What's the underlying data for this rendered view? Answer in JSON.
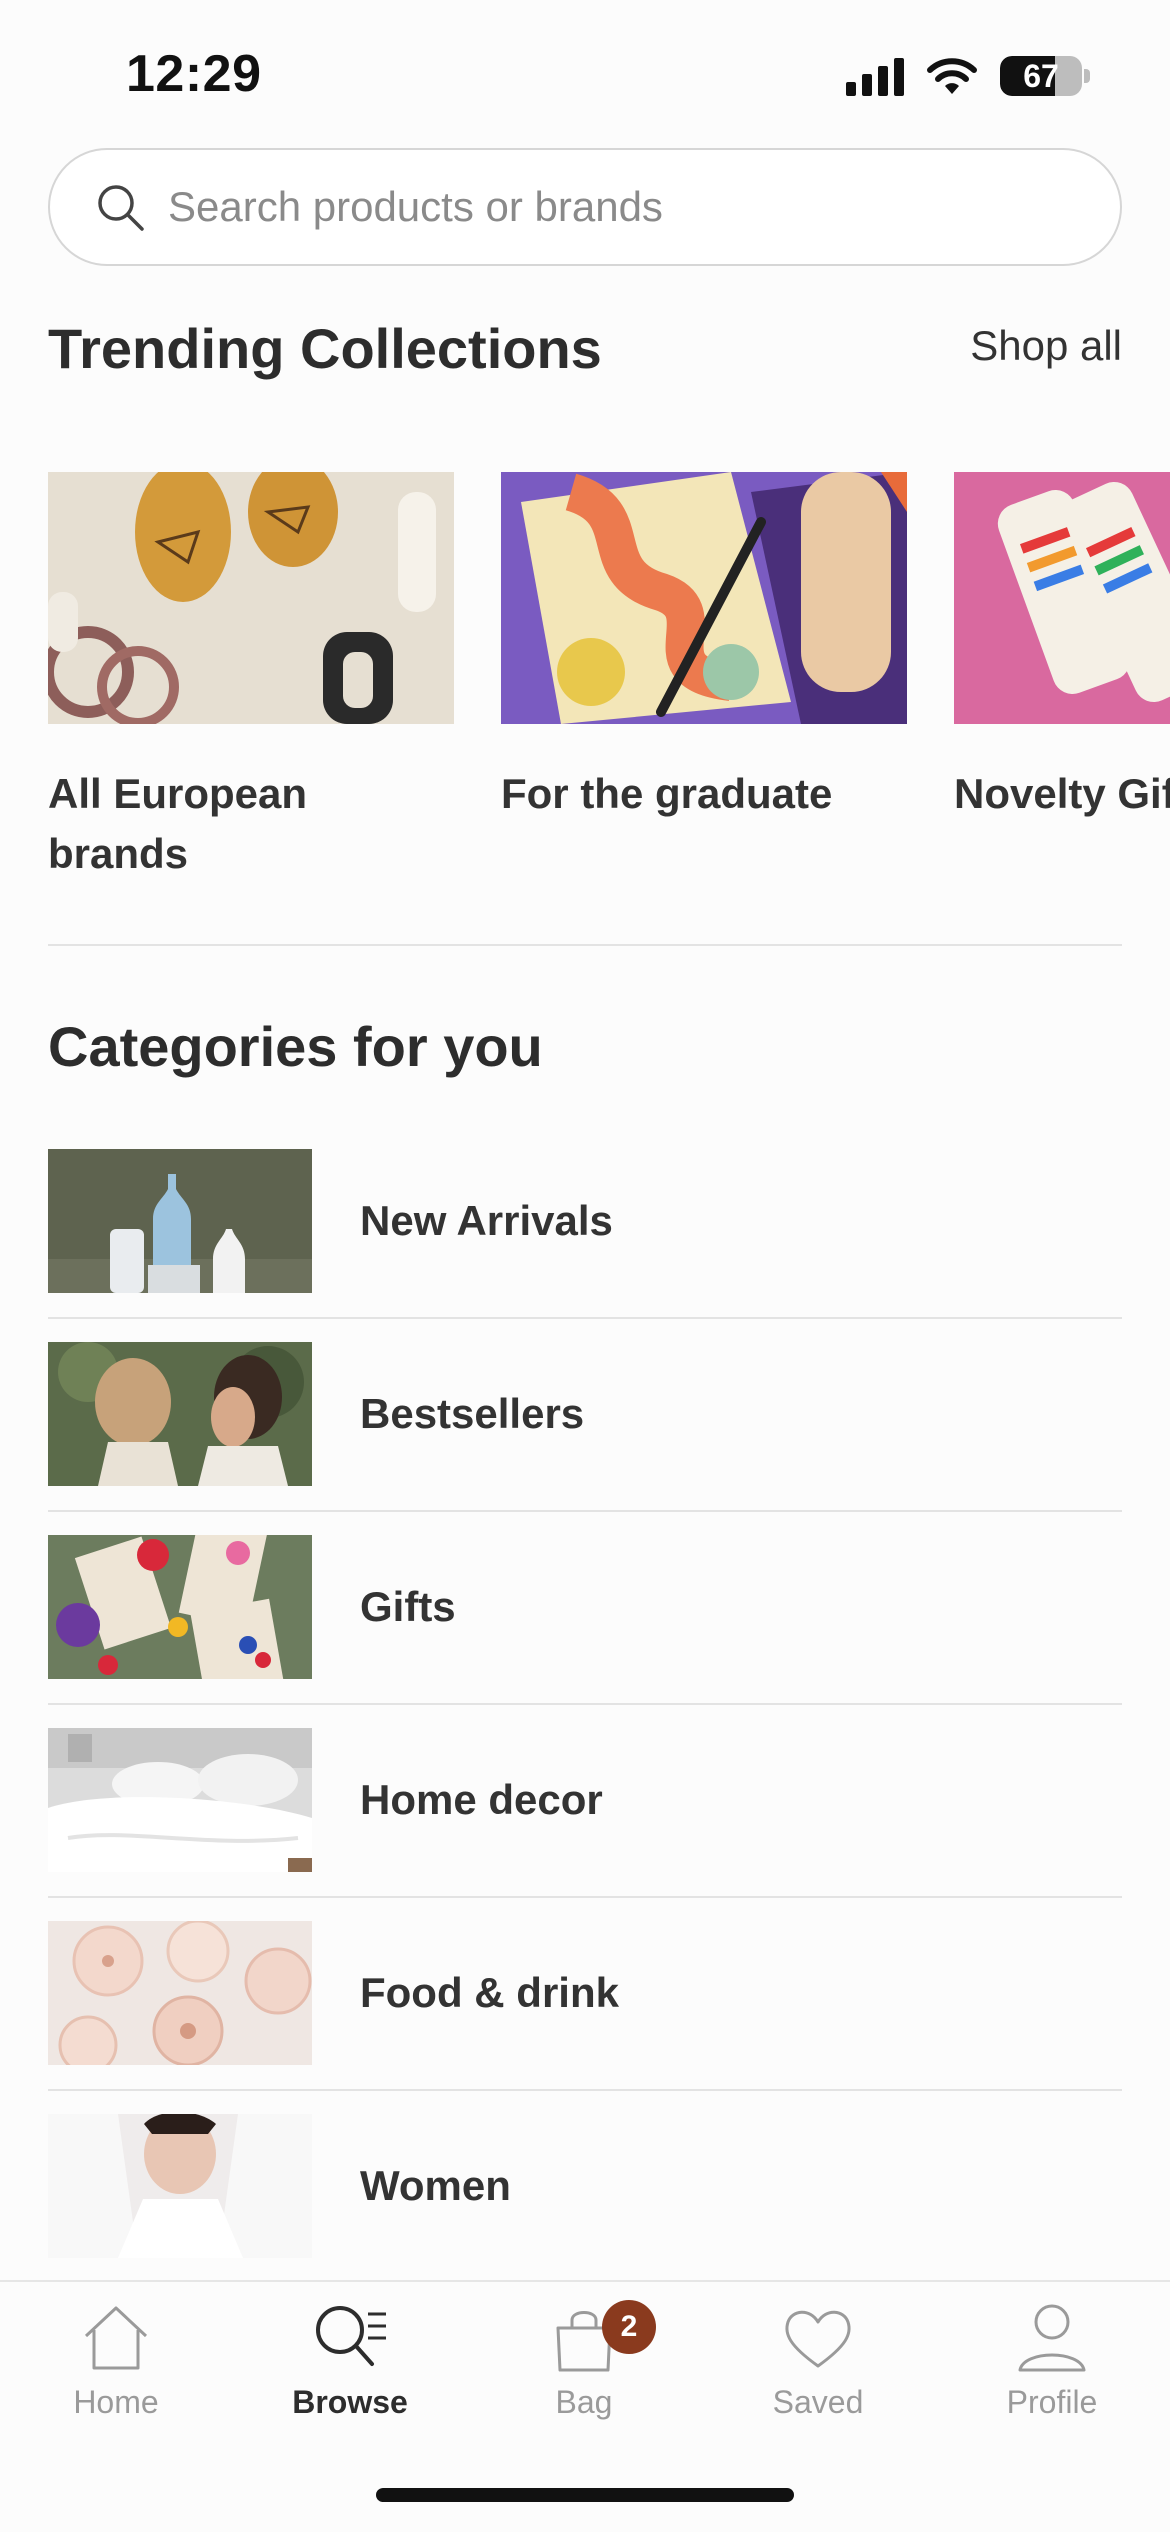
{
  "status": {
    "time": "12:29",
    "battery": "67",
    "battery_level": 0.67
  },
  "search": {
    "placeholder": "Search products or brands"
  },
  "trending": {
    "title": "Trending Collections",
    "shop_all": "Shop all",
    "items": [
      {
        "label": "All European brands"
      },
      {
        "label": "For the graduate"
      },
      {
        "label": "Novelty Gifts"
      }
    ]
  },
  "categories": {
    "title": "Categories for you",
    "items": [
      {
        "label": "New Arrivals"
      },
      {
        "label": "Bestsellers"
      },
      {
        "label": "Gifts"
      },
      {
        "label": "Home decor"
      },
      {
        "label": "Food & drink"
      },
      {
        "label": "Women"
      }
    ]
  },
  "tabbar": {
    "home": "Home",
    "browse": "Browse",
    "bag": "Bag",
    "bag_count": "2",
    "saved": "Saved",
    "profile": "Profile"
  },
  "colors": {
    "badge": "#8a3a1e",
    "text": "#333333",
    "muted": "#9a9a9a"
  }
}
